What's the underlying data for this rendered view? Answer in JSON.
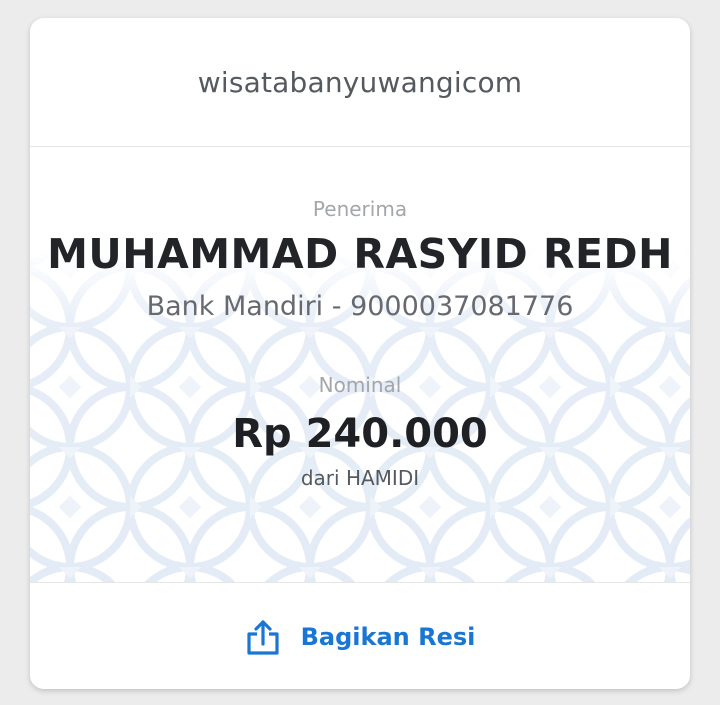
{
  "header": {
    "site_name": "wisatabanyuwangicom"
  },
  "recipient": {
    "label": "Penerima",
    "name": "MUHAMMAD RASYID REDH",
    "bank_info": "Bank Mandiri - 9000037081776"
  },
  "transfer": {
    "label": "Nominal",
    "amount": "Rp 240.000",
    "sender": "dari HAMIDI"
  },
  "footer": {
    "share_label": "Bagikan Resi",
    "share_icon": "share-icon"
  },
  "colors": {
    "accent": "#1976d2",
    "pattern": "#e3ebf6"
  }
}
